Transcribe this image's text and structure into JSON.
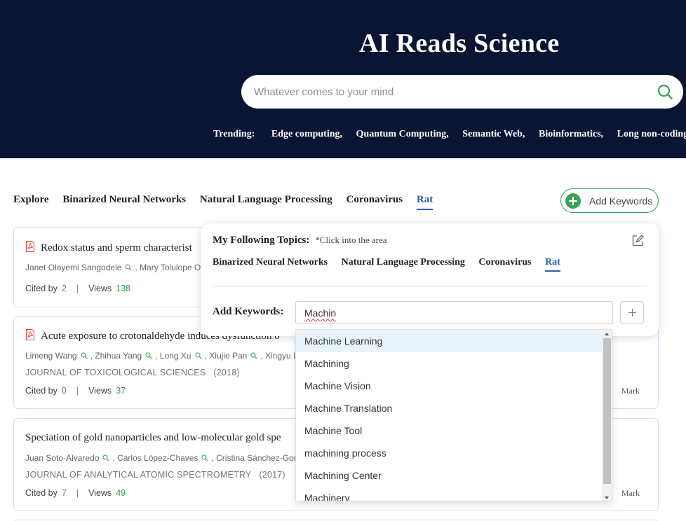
{
  "header": {
    "title": "AI Reads Science",
    "search_placeholder": "Whatever comes to your mind",
    "trending_label": "Trending:",
    "trending": [
      "Edge computing,",
      "Quantum Computing,",
      "Semantic Web,",
      "Bioinformatics,",
      "Long non-coding"
    ]
  },
  "tabs": [
    {
      "label": "Explore"
    },
    {
      "label": "Binarized Neural Networks"
    },
    {
      "label": "Natural Language Processing"
    },
    {
      "label": "Coronavirus"
    },
    {
      "label": "Rat"
    }
  ],
  "add_keywords_button": "Add Keywords",
  "papers": [
    {
      "title": "Redox status and sperm characterist",
      "authors": [
        "Janet Olayemi Sangodele",
        "Mary Tolulope Ol"
      ],
      "journal": "",
      "cited_label": "Cited by",
      "cited": "2",
      "views_label": "Views",
      "views": "138",
      "mark": ""
    },
    {
      "title": "Acute exposure to crotonaldehyde induces dysfunction o",
      "authors": [
        "Limeng Wang",
        "Zhihua Yang",
        "Long Xu",
        "Xiujie Pan",
        "Xingyu Li"
      ],
      "journal": "JOURNAL OF TOXICOLOGICAL SCIENCES",
      "year": "(2018)",
      "cited_label": "Cited by",
      "cited": "0",
      "views_label": "Views",
      "views": "37",
      "mark": "Mark"
    },
    {
      "title": "Speciation of gold nanoparticles and low-molecular gold spe",
      "authors": [
        "Juan Soto-Alvaredo",
        "Carlos López-Chaves",
        "Cristina Sánchez-Gonz"
      ],
      "journal": "JOURNAL OF ANALYTICAL ATOMIC SPECTROMETRY",
      "year": "(2017)",
      "cited_label": "Cited by",
      "cited": "7",
      "views_label": "Views",
      "views": "49",
      "mark": "Mark"
    }
  ],
  "popup": {
    "title": "My Following Topics:",
    "hint": "*Click into the area",
    "topics": [
      "Binarized Neural Networks",
      "Natural Language Processing",
      "Coronavirus",
      "Rat"
    ],
    "add_keywords_label": "Add Keywords:",
    "input_value": "Machin"
  },
  "suggestions": [
    "Machine Learning",
    "Machining",
    "Machine Vision",
    "Machine Translation",
    "Machine Tool",
    "machining process",
    "Machining Center",
    "Machinery"
  ],
  "colors": {
    "header_bg": "#0a1433",
    "accent_green": "#3aa157",
    "accent_blue": "#2a5db0"
  }
}
